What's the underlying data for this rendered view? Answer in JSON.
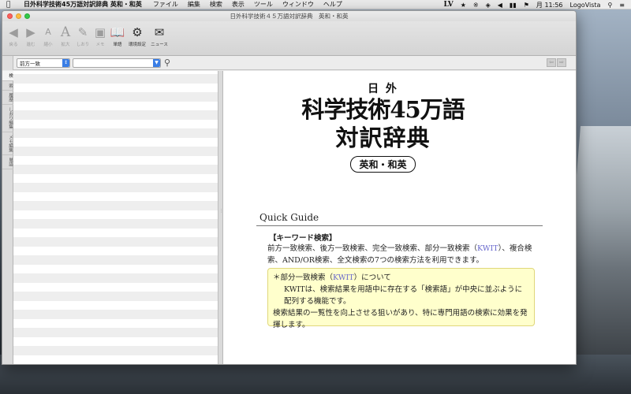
{
  "menubar": {
    "app_name": "日外科学技術45万語対訳辞典 英和・和英",
    "items": [
      "ファイル",
      "編集",
      "検索",
      "表示",
      "ツール",
      "ウィンドウ",
      "ヘルプ"
    ],
    "status_lv": "LV",
    "clock": "月 11:56",
    "input_app": "LogoVista"
  },
  "window": {
    "title": "日外科学技術４５万語対訳辞典　英和・和英"
  },
  "toolbar": {
    "buttons": [
      {
        "label": "戻る",
        "icon": "back-arrow-icon",
        "enabled": false
      },
      {
        "label": "進む",
        "icon": "forward-arrow-icon",
        "enabled": false
      },
      {
        "label": "縮小",
        "icon": "font-smaller-icon",
        "enabled": false
      },
      {
        "label": "拡大",
        "icon": "font-larger-icon",
        "enabled": false
      },
      {
        "label": "しおり",
        "icon": "bookmark-icon",
        "enabled": false
      },
      {
        "label": "メモ",
        "icon": "memo-icon",
        "enabled": false
      },
      {
        "label": "単語",
        "icon": "word-book-icon",
        "enabled": true
      },
      {
        "label": "環境設定",
        "icon": "gear-icon",
        "enabled": true
      },
      {
        "label": "ニュース",
        "icon": "news-icon",
        "enabled": true
      }
    ]
  },
  "search": {
    "mode_value": "前方一致",
    "query_value": ""
  },
  "sidetabs": [
    "検",
    "索",
    "履歴",
    "しおり編集",
    "メモ編集",
    "単語"
  ],
  "logo": {
    "line1": "日 外",
    "line2": "科学技術45万語",
    "line3": "対訳辞典",
    "badge": "英和・和英"
  },
  "guide": {
    "title": "Quick Guide",
    "keyword_heading": "【キーワード検索】",
    "keyword_text_1": "前方一致検索、後方一致検索、完全一致検索、部分一致検索（",
    "kwit_link": "KWIT",
    "keyword_text_2": "）、複合検索、AND/OR検索、全文検索の7つの検索方法を利用できます。",
    "note_line1_a": "＊部分一致検索（",
    "note_line1_b": "）について",
    "note_line2": "KWITは、検索結果を用語中に存在する「検索語」が中央に並ぶように配列する機能です。",
    "note_line3": "検索結果の一覧性を向上させる狙いがあり、特に専門用語の検索に効果を発揮します。"
  },
  "colors": {
    "link": "#6666cc",
    "note_bg": "#ffffcc",
    "accent": "#3a7ee6"
  }
}
